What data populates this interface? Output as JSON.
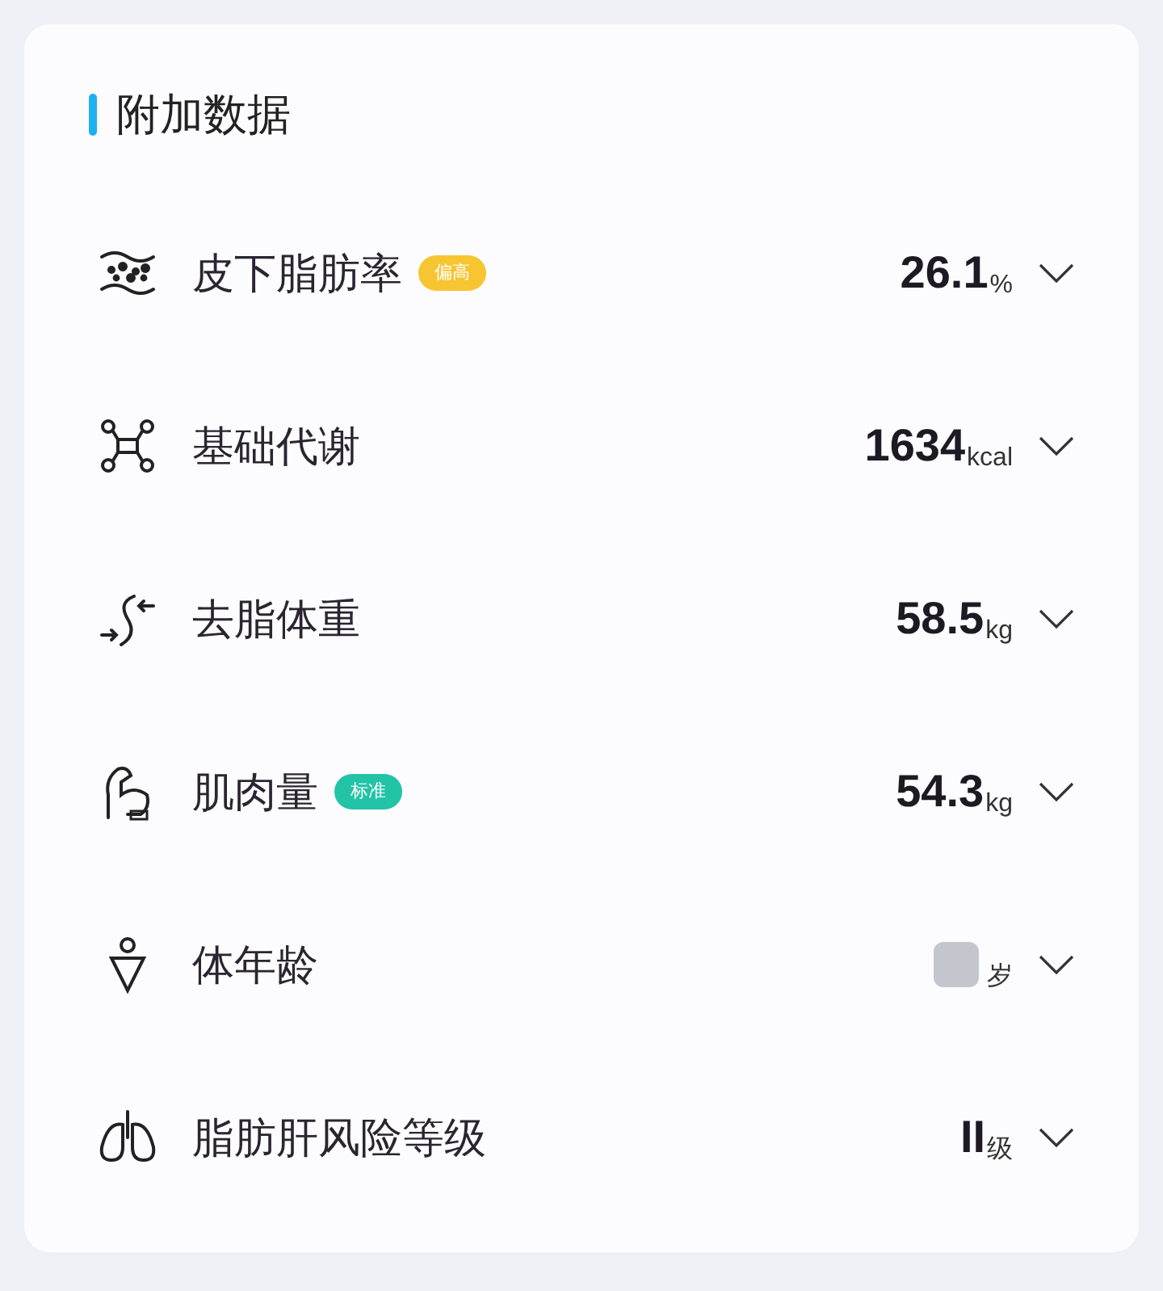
{
  "card": {
    "title": "附加数据"
  },
  "items": [
    {
      "label": "皮下脂肪率",
      "badge": {
        "text": "偏高",
        "color": "#f7c531"
      },
      "value": "26.1",
      "unit": "%"
    },
    {
      "label": "基础代谢",
      "value": "1634",
      "unit": "kcal"
    },
    {
      "label": "去脂体重",
      "value": "58.5",
      "unit": "kg"
    },
    {
      "label": "肌肉量",
      "badge": {
        "text": "标准",
        "color": "#22c3a6"
      },
      "value": "54.3",
      "unit": "kg"
    },
    {
      "label": "体年龄",
      "redacted": true,
      "unit": "岁"
    },
    {
      "label": "脂肪肝风险等级",
      "value": "II",
      "unit": "级"
    }
  ]
}
